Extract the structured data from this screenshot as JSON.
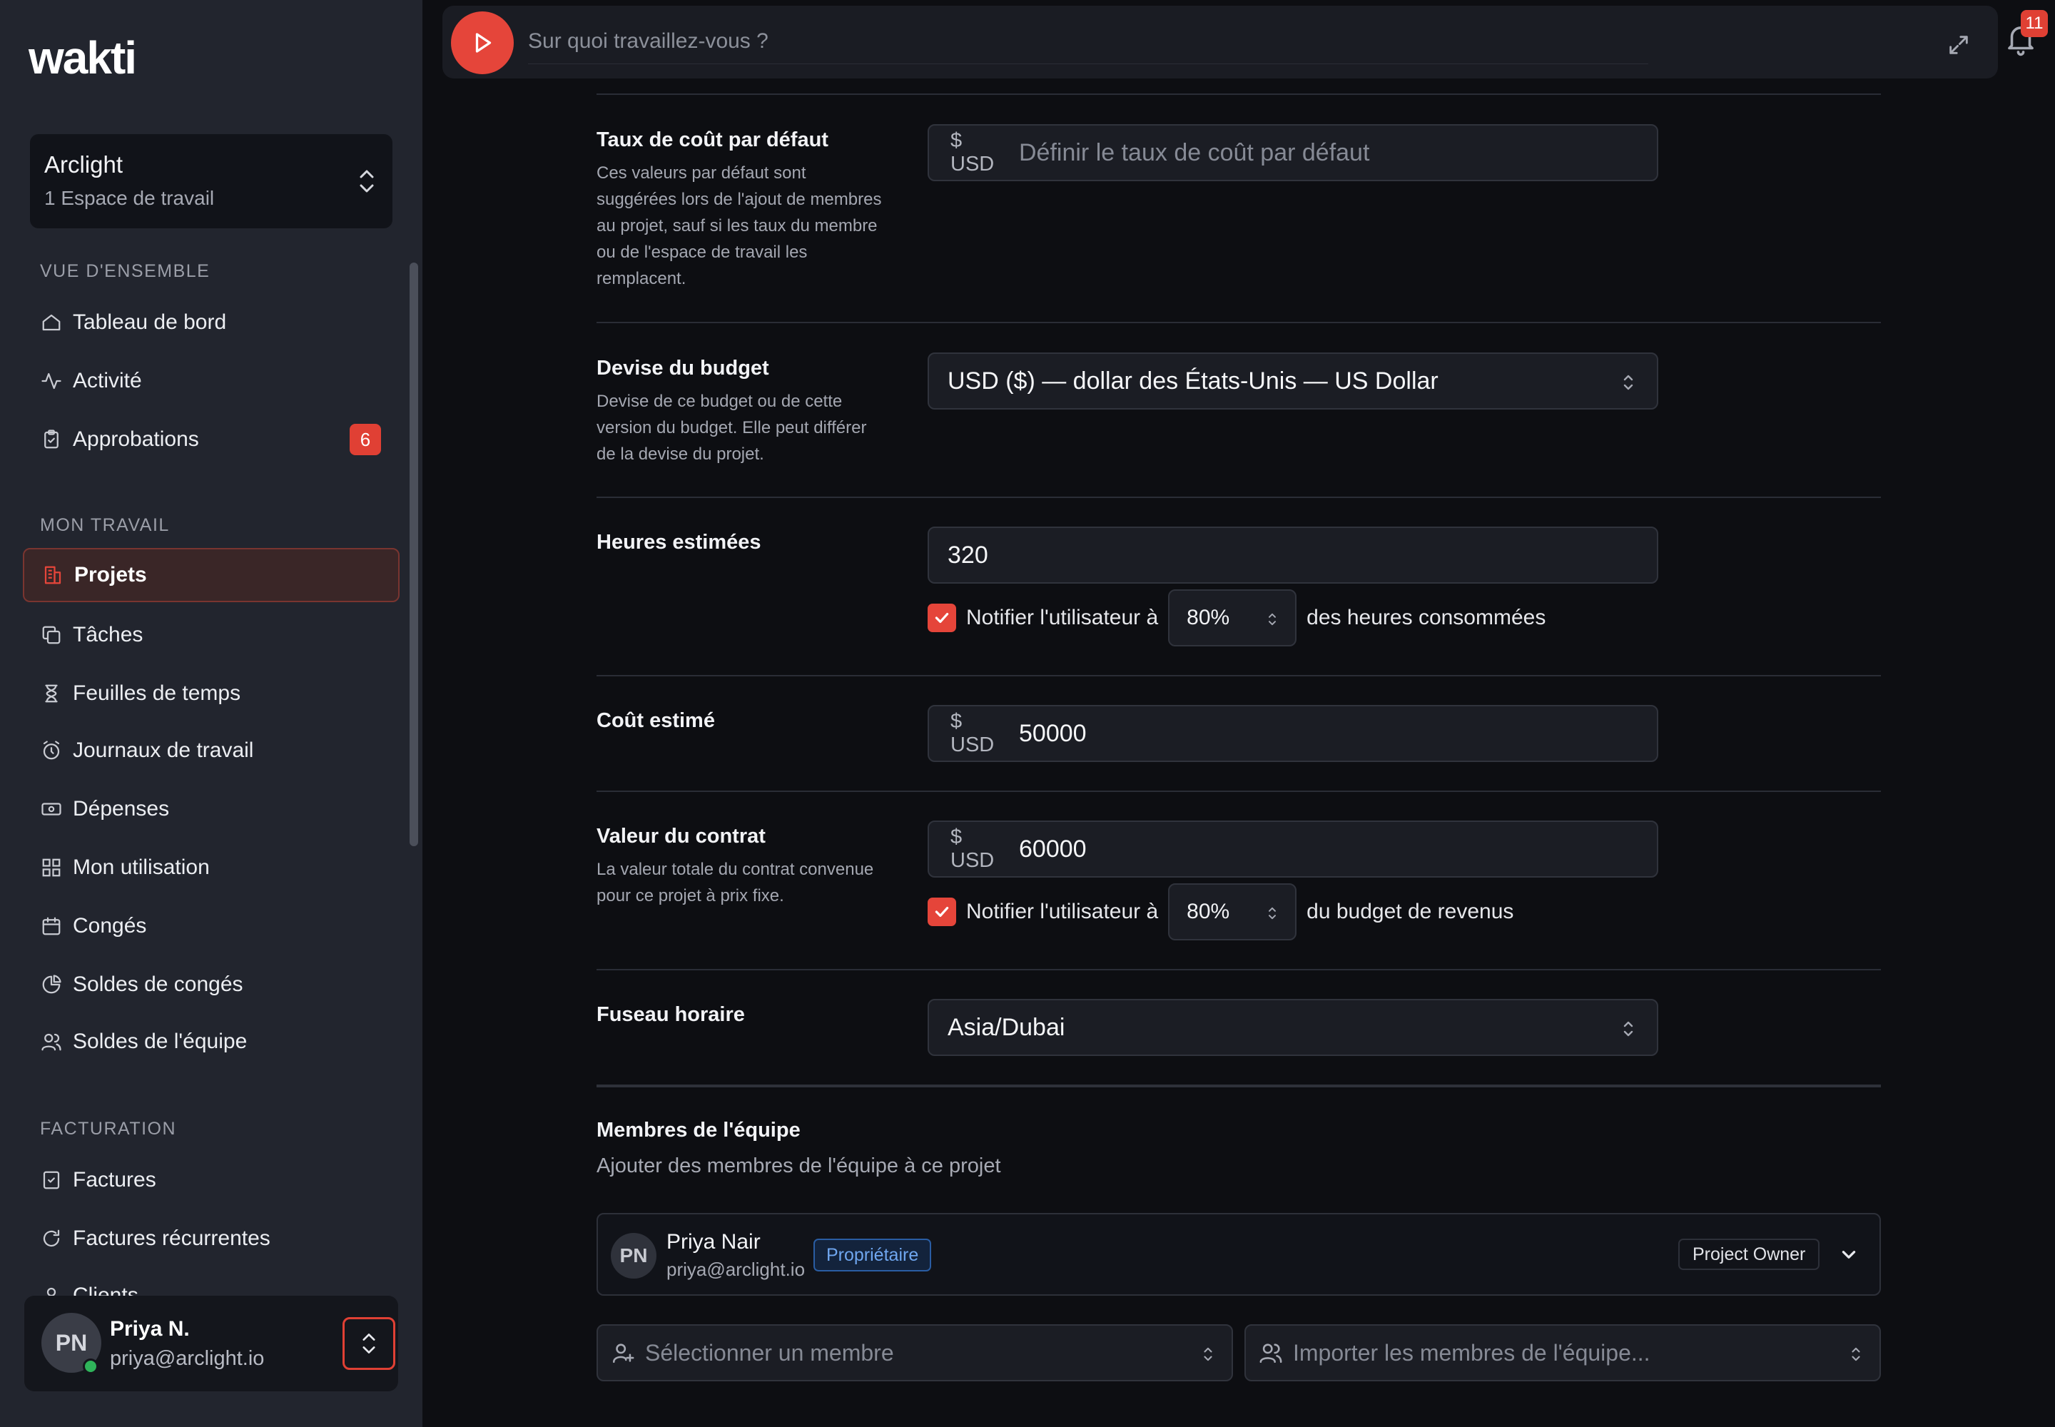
{
  "app": {
    "logo": "wakti"
  },
  "workspace": {
    "name": "Arclight",
    "subtitle": "1 Espace de travail"
  },
  "sidebar": {
    "sections": [
      {
        "title": "VUE D'ENSEMBLE"
      },
      {
        "title": "MON TRAVAIL"
      },
      {
        "title": "FACTURATION"
      }
    ],
    "overview": [
      {
        "label": "Tableau de bord",
        "icon": "home-icon"
      },
      {
        "label": "Activité",
        "icon": "activity-icon"
      },
      {
        "label": "Approbations",
        "icon": "clipboard-check-icon",
        "badge": "6"
      }
    ],
    "work": [
      {
        "label": "Projets",
        "icon": "building-icon",
        "active": true
      },
      {
        "label": "Tâches",
        "icon": "copy-icon"
      },
      {
        "label": "Feuilles de temps",
        "icon": "hourglass-icon"
      },
      {
        "label": "Journaux de travail",
        "icon": "alarm-clock-icon"
      },
      {
        "label": "Dépenses",
        "icon": "banknote-icon"
      },
      {
        "label": "Mon utilisation",
        "icon": "grid-icon"
      },
      {
        "label": "Congés",
        "icon": "calendar-icon"
      },
      {
        "label": "Soldes de congés",
        "icon": "pie-chart-icon"
      },
      {
        "label": "Soldes de l'équipe",
        "icon": "users-icon"
      }
    ],
    "billing": [
      {
        "label": "Factures",
        "icon": "invoice-check-icon"
      },
      {
        "label": "Factures récurrentes",
        "icon": "refresh-icon"
      },
      {
        "label": "Clients",
        "icon": "client-icon"
      }
    ]
  },
  "user": {
    "initials": "PN",
    "name": "Priya N.",
    "email": "priya@arclight.io",
    "status": "online"
  },
  "topbar": {
    "search_placeholder": "Sur quoi travaillez-vous ?",
    "notifications_count": "11"
  },
  "form": {
    "default_cost_rate": {
      "label": "Taux de coût par défaut",
      "help": "Ces valeurs par défaut sont suggérées lors de l'ajout de membres au projet, sauf si les taux du membre ou de l'espace de travail les remplacent.",
      "prefix": "$ USD",
      "placeholder": "Définir le taux de coût par défaut"
    },
    "budget_currency": {
      "label": "Devise du budget",
      "help": "Devise de ce budget ou de cette version du budget. Elle peut différer de la devise du projet.",
      "value": "USD ($) — dollar des États-Unis — US Dollar"
    },
    "estimated_hours": {
      "label": "Heures estimées",
      "value": "320",
      "notify": {
        "checked": true,
        "before": "Notifier l'utilisateur à",
        "percent": "80%",
        "after": "des heures consommées"
      }
    },
    "estimated_cost": {
      "label": "Coût estimé",
      "prefix": "$ USD",
      "value": "50000"
    },
    "contract_value": {
      "label": "Valeur du contrat",
      "help": "La valeur totale du contrat convenue pour ce projet à prix fixe.",
      "prefix": "$ USD",
      "value": "60000",
      "notify": {
        "checked": true,
        "before": "Notifier l'utilisateur à",
        "percent": "80%",
        "after": "du budget de revenus"
      }
    },
    "timezone": {
      "label": "Fuseau horaire",
      "value": "Asia/Dubai"
    }
  },
  "team": {
    "title": "Membres de l'équipe",
    "subtitle": "Ajouter des membres de l'équipe à ce projet",
    "members": [
      {
        "initials": "PN",
        "name": "Priya Nair",
        "email": "priya@arclight.io",
        "badge": "Propriétaire",
        "role": "Project Owner"
      }
    ],
    "select_member_placeholder": "Sélectionner un membre",
    "import_members_placeholder": "Importer les membres de l'équipe..."
  },
  "colors": {
    "accent": "#e5453a",
    "sidebar_bg": "#22252e",
    "main_bg": "#0d0e12",
    "info_badge": "#6fa6ef",
    "online": "#2fb45a"
  }
}
